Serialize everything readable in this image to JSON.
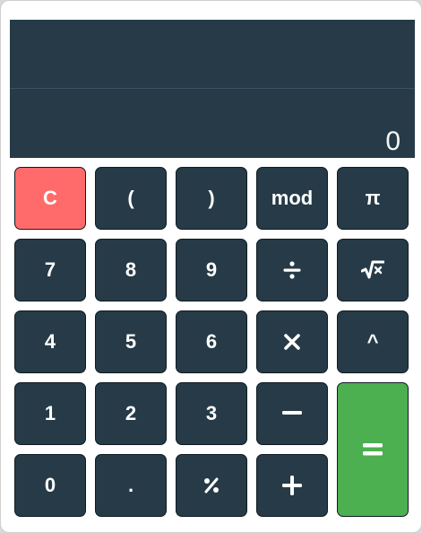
{
  "display": {
    "expression": "",
    "result": "0"
  },
  "keys": {
    "clear": "C",
    "open_paren": "(",
    "close_paren": ")",
    "mod": "mod",
    "pi": "π",
    "seven": "7",
    "eight": "8",
    "nine": "9",
    "four": "4",
    "five": "5",
    "six": "6",
    "one": "1",
    "two": "2",
    "three": "3",
    "zero": "0",
    "dot": ".",
    "power": "^"
  },
  "icons": {
    "divide": "divide-icon",
    "sqrt": "square-root-icon",
    "multiply": "multiply-icon",
    "minus": "minus-icon",
    "percent": "percent-icon",
    "plus": "plus-icon",
    "equals": "equals-icon"
  },
  "colors": {
    "display_bg": "#263b47",
    "key_bg": "#263b47",
    "clear_bg": "#ff6b6b",
    "equals_bg": "#4caf50"
  }
}
